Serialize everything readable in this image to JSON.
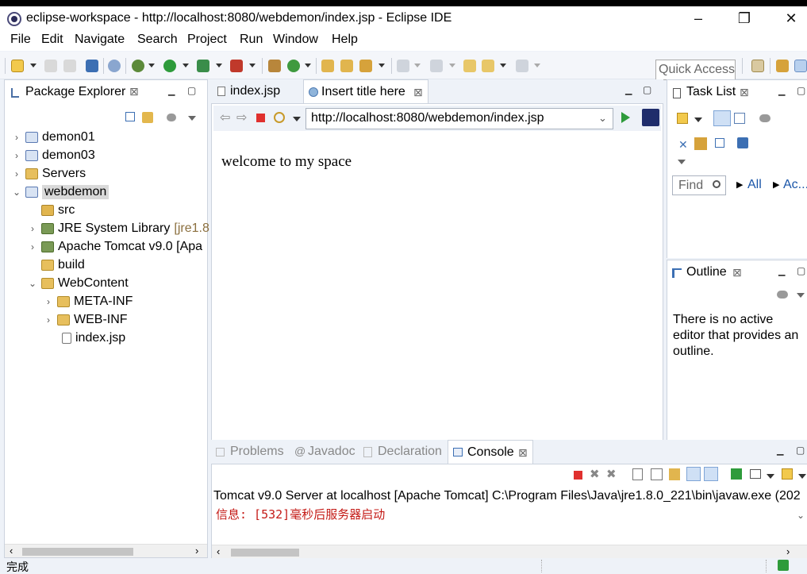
{
  "window": {
    "title": "eclipse-workspace - http://localhost:8080/webdemon/index.jsp - Eclipse IDE",
    "minimize": "–",
    "restore": "❐",
    "close": "✕"
  },
  "menu": [
    "File",
    "Edit",
    "Navigate",
    "Search",
    "Project",
    "Run",
    "Window",
    "Help"
  ],
  "toolbar": {
    "quick_access": "Quick Access"
  },
  "package_explorer": {
    "title": "Package Explorer",
    "close": "⊠",
    "items": [
      {
        "label": "demon01",
        "chevron": "›",
        "icon": "project"
      },
      {
        "label": "demon03",
        "chevron": "›",
        "icon": "project"
      },
      {
        "label": "Servers",
        "chevron": "›",
        "icon": "folder"
      },
      {
        "label": "webdemon",
        "chevron": "⌄",
        "icon": "project"
      },
      {
        "label": "src",
        "chevron": "",
        "icon": "package"
      },
      {
        "label": "JRE System Library",
        "suffix": "[jre1.8",
        "chevron": "›",
        "icon": "library"
      },
      {
        "label": "Apache Tomcat v9.0 [Apa",
        "chevron": "›",
        "icon": "library"
      },
      {
        "label": "build",
        "chevron": "",
        "icon": "folder"
      },
      {
        "label": "WebContent",
        "chevron": "⌄",
        "icon": "folder"
      },
      {
        "label": "META-INF",
        "chevron": "›",
        "icon": "folder"
      },
      {
        "label": "WEB-INF",
        "chevron": "›",
        "icon": "folder"
      },
      {
        "label": "index.jsp",
        "chevron": "",
        "icon": "file"
      }
    ]
  },
  "editor": {
    "tabs": [
      {
        "label": "index.jsp",
        "active": false
      },
      {
        "label": "Insert title here",
        "active": true
      }
    ],
    "url": "http://localhost:8080/webdemon/index.jsp",
    "content": "welcome to my space"
  },
  "task_list": {
    "title": "Task List",
    "find_placeholder": "Find",
    "all": "All",
    "activate": "Ac..."
  },
  "outline": {
    "title": "Outline",
    "message": "There is no active editor that provides an outline."
  },
  "bottom": {
    "tabs": [
      "Problems",
      "Javadoc",
      "Declaration",
      "Console"
    ],
    "active_tab": "Console",
    "console_header": "Tomcat v9.0 Server at localhost [Apache Tomcat] C:\\Program Files\\Java\\jre1.8.0_221\\bin\\javaw.exe (202",
    "console_line": "信息: [532]毫秒后服务器启动"
  },
  "status": {
    "text": "完成"
  }
}
